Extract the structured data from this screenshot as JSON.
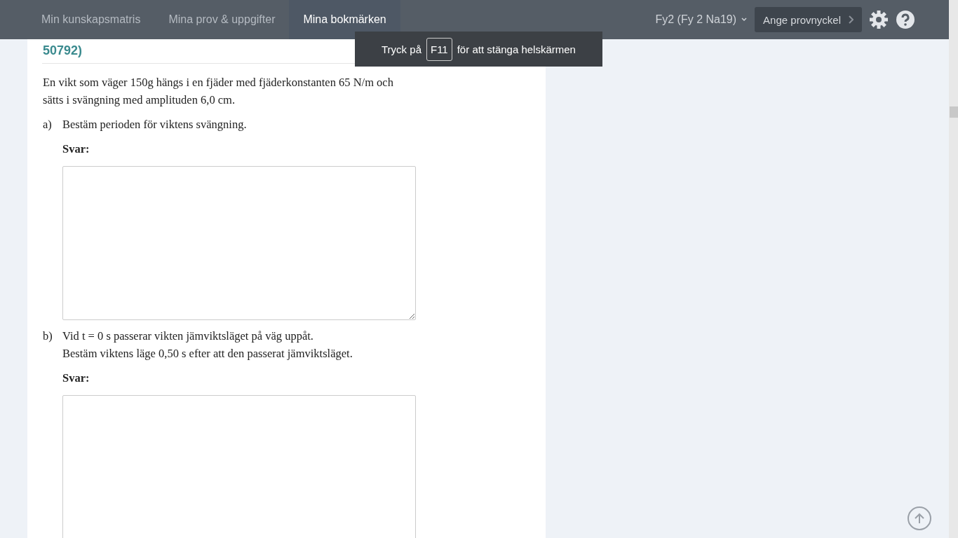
{
  "nav": {
    "tabs": [
      {
        "label": "Min kunskapsmatris",
        "selected": false
      },
      {
        "label": "Mina prov & uppgifter",
        "selected": false
      },
      {
        "label": "Mina bokmärken",
        "selected": true
      }
    ],
    "course": "Fy2 (Fy 2 Na19)",
    "key_button": "Ange provnyckel"
  },
  "toast": {
    "before": "Tryck på",
    "key": "F11",
    "after": "för att stänga helskärmen"
  },
  "question": {
    "heading": "50792)",
    "intro": "En vikt som väger 150g hängs i en fjäder med fjäderkonstanten 65 N/m och sätts i svängning med amplituden 6,0 cm.",
    "parts": [
      {
        "label": "a)",
        "lines": [
          "Bestäm perioden för viktens svängning."
        ],
        "answer_label": "Svar:"
      },
      {
        "label": "b)",
        "lines": [
          "Vid t = 0 s passerar vikten jämviktsläget på väg uppåt.",
          "Bestäm viktens läge 0,50 s efter att den passerat jämviktsläget."
        ],
        "answer_label": "Svar:"
      }
    ]
  }
}
